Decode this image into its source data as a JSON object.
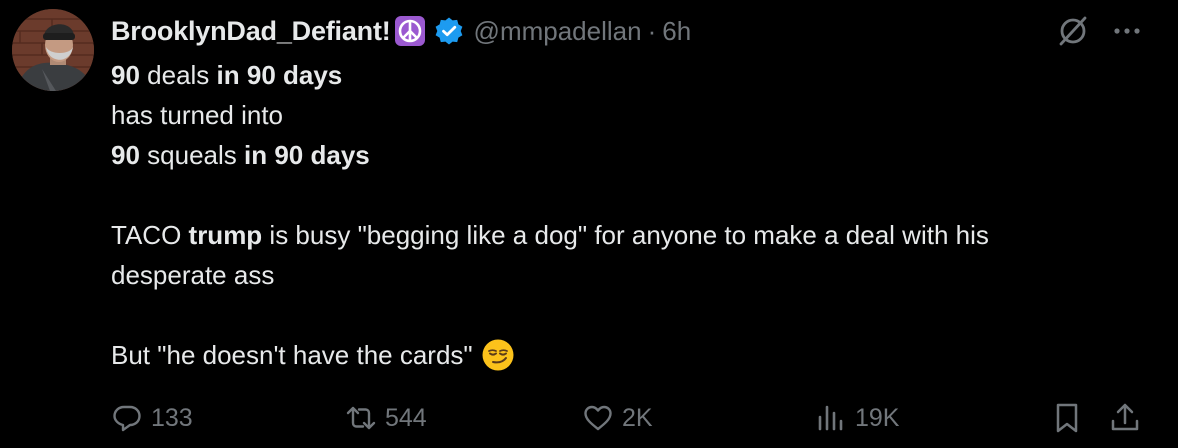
{
  "tweet": {
    "author": {
      "display_name": "BrooklynDad_Defiant!",
      "handle": "@mmpadellan",
      "separator": "·",
      "time": "6h",
      "verified": true,
      "badge_emoji": "☮️"
    },
    "body": {
      "line1": {
        "a": "90",
        "b": " deals ",
        "c": "in 90 days"
      },
      "line2": "has turned into",
      "line3": {
        "a": "90",
        "b": " squeals ",
        "c": "in 90 days"
      },
      "line4": {
        "a": "TACO ",
        "b": "trump",
        "c": " is busy \"begging like a dog\" for anyone to make a deal with his"
      },
      "line5": "desperate ass",
      "line6": "But \"he doesn't have the cards\"",
      "emoji": "smirking-face"
    },
    "stats": {
      "replies": "133",
      "reposts": "544",
      "likes": "2K",
      "views": "19K"
    }
  },
  "colors": {
    "background": "#000000",
    "text": "#e7e9ea",
    "secondary": "#71767b",
    "verified": "#1d9bf0",
    "peace_badge": "#9b59d0"
  }
}
